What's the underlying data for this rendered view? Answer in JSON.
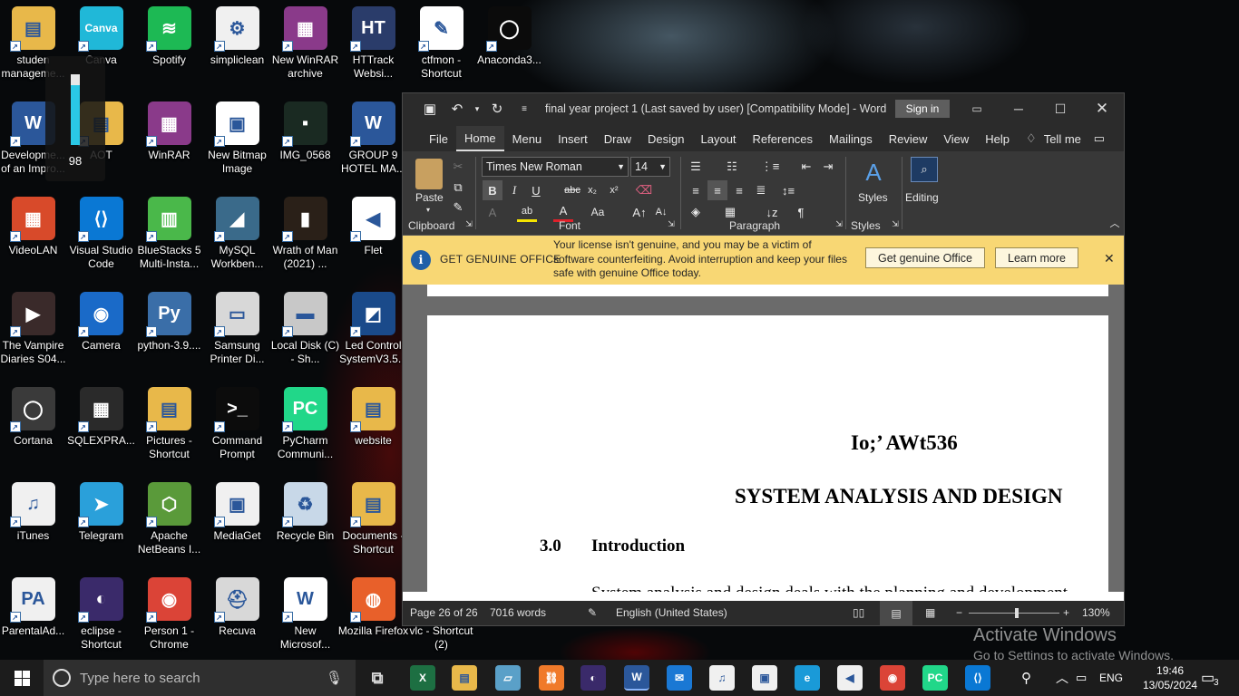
{
  "desktop": {
    "icons": [
      {
        "label": "studen manageme...",
        "icon": "folder-icon",
        "color": "#e8b84a",
        "glyph": "▤"
      },
      {
        "label": "Canva",
        "icon": "canva-icon",
        "color": "#20b8d8",
        "glyph": "Canva"
      },
      {
        "label": "Spotify",
        "icon": "spotify-icon",
        "color": "#1db954",
        "glyph": "≋"
      },
      {
        "label": "simpliclean",
        "icon": "gear-icon",
        "color": "#f0f0f0",
        "glyph": "⚙"
      },
      {
        "label": "New WinRAR archive",
        "icon": "winrar-icon",
        "color": "#8a3a8a",
        "glyph": "▦"
      },
      {
        "label": "HTTrack Websi...",
        "icon": "httrack-icon",
        "color": "#2a3c6a",
        "glyph": "HT"
      },
      {
        "label": "ctfmon - Shortcut",
        "icon": "ctfmon-icon",
        "color": "#ffffff",
        "glyph": "✎"
      },
      {
        "label": "Anaconda3...",
        "icon": "anaconda-icon",
        "color": "#0b0b0b",
        "glyph": "◯"
      },
      {
        "label": "Developme... of an Impro...",
        "icon": "word-document-icon",
        "color": "#2b579a",
        "glyph": "W"
      },
      {
        "label": "AOT",
        "icon": "folder-icon",
        "color": "#e8b84a",
        "glyph": "▤"
      },
      {
        "label": "WinRAR",
        "icon": "winrar-icon",
        "color": "#8a3a8a",
        "glyph": "▦"
      },
      {
        "label": "New Bitmap Image",
        "icon": "bitmap-icon",
        "color": "#ffffff",
        "glyph": "▣"
      },
      {
        "label": "IMG_0568",
        "icon": "image-icon",
        "color": "#1a2a22",
        "glyph": "▪"
      },
      {
        "label": "GROUP 9 HOTEL MA...",
        "icon": "word-document-icon",
        "color": "#2b579a",
        "glyph": "W"
      },
      {
        "label": "VideoLAN",
        "icon": "winrar-icon",
        "color": "#d84a2a",
        "glyph": "▦"
      },
      {
        "label": "Visual Studio Code",
        "icon": "vscode-icon",
        "color": "#0a78d4",
        "glyph": "⟨⟩"
      },
      {
        "label": "BlueStacks 5 Multi-Insta...",
        "icon": "bluestacks-icon",
        "color": "#4ab84a",
        "glyph": "▥"
      },
      {
        "label": "MySQL Workben...",
        "icon": "mysql-icon",
        "color": "#3a6a8a",
        "glyph": "◢"
      },
      {
        "label": "Wrath of Man (2021) ...",
        "icon": "movie-icon",
        "color": "#2a2018",
        "glyph": "▮"
      },
      {
        "label": "Flet",
        "icon": "flet-icon",
        "color": "#ffffff",
        "glyph": "◀"
      },
      {
        "label": "The Vampire Diaries S04...",
        "icon": "video-icon",
        "color": "#3a2a2a",
        "glyph": "▶"
      },
      {
        "label": "Camera",
        "icon": "camera-icon",
        "color": "#1a6ac8",
        "glyph": "◉"
      },
      {
        "label": "python-3.9....",
        "icon": "python-icon",
        "color": "#3a6ea8",
        "glyph": "Py"
      },
      {
        "label": "Samsung Printer Di...",
        "icon": "printer-icon",
        "color": "#d8d8d8",
        "glyph": "▭"
      },
      {
        "label": "Local Disk (C) - Sh...",
        "icon": "disk-icon",
        "color": "#c8c8c8",
        "glyph": "▬"
      },
      {
        "label": "Led Control SystemV3.5...",
        "icon": "led-icon",
        "color": "#1a4a8a",
        "glyph": "◩"
      },
      {
        "label": "Cortana",
        "icon": "cortana-icon",
        "color": "#3a3a3a",
        "glyph": "◯"
      },
      {
        "label": "SQLEXPRA...",
        "icon": "sqlexpress-icon",
        "color": "#2a2a2a",
        "glyph": "▦"
      },
      {
        "label": "Pictures - Shortcut",
        "icon": "folder-icon",
        "color": "#e8b84a",
        "glyph": "▤"
      },
      {
        "label": "Command Prompt",
        "icon": "terminal-icon",
        "color": "#0c0c0c",
        "glyph": ">_"
      },
      {
        "label": "PyCharm Communi...",
        "icon": "pycharm-icon",
        "color": "#21d789",
        "glyph": "PC"
      },
      {
        "label": "website",
        "icon": "folder-icon",
        "color": "#e8b84a",
        "glyph": "▤"
      },
      {
        "label": "iTunes",
        "icon": "itunes-icon",
        "color": "#f0f0f0",
        "glyph": "♫"
      },
      {
        "label": "Telegram",
        "icon": "telegram-icon",
        "color": "#2aa0da",
        "glyph": "➤"
      },
      {
        "label": "Apache NetBeans I...",
        "icon": "netbeans-icon",
        "color": "#5a9a3a",
        "glyph": "⬡"
      },
      {
        "label": "MediaGet",
        "icon": "mediaget-icon",
        "color": "#f0f0f0",
        "glyph": "▣"
      },
      {
        "label": "Recycle Bin",
        "icon": "recycle-bin-icon",
        "color": "#c8d8e8",
        "glyph": "♻"
      },
      {
        "label": "Documents - Shortcut",
        "icon": "folder-icon",
        "color": "#e8b84a",
        "glyph": "▤"
      },
      {
        "label": "ParentalAd...",
        "icon": "parental-advisory-icon",
        "color": "#f0f0f0",
        "glyph": "PA"
      },
      {
        "label": "eclipse - Shortcut",
        "icon": "eclipse-icon",
        "color": "#3a2a6a",
        "glyph": "◐"
      },
      {
        "label": "Person 1 - Chrome",
        "icon": "chrome-icon",
        "color": "#db4437",
        "glyph": "◉"
      },
      {
        "label": "Recuva",
        "icon": "recuva-icon",
        "color": "#d8d8d8",
        "glyph": "⛑"
      },
      {
        "label": "New Microsof...",
        "icon": "word-document-icon",
        "color": "#ffffff",
        "glyph": "W"
      },
      {
        "label": "Mozilla Firefox",
        "icon": "firefox-icon",
        "color": "#e8602a",
        "glyph": "◍"
      },
      {
        "label": "vlc - Shortcut (2)",
        "icon": "vlc-icon",
        "color": "#e88a1a",
        "glyph": "▲"
      }
    ],
    "widget_value": "98",
    "widget_fill": 0.98,
    "activate_title": "Activate Windows",
    "activate_sub": "Go to Settings to activate Windows."
  },
  "word": {
    "title": "final year project 1 (Last saved by user) [Compatibility Mode]  -  Word",
    "sign_in": "Sign in",
    "tabs": [
      "File",
      "Home",
      "Menu",
      "Insert",
      "Draw",
      "Design",
      "Layout",
      "References",
      "Mailings",
      "Review",
      "View",
      "Help"
    ],
    "tell_me": "Tell me",
    "ribbon": {
      "paste": "Paste",
      "clipboard": "Clipboard",
      "font_name": "Times New Roman",
      "font_size": "14",
      "font": "Font",
      "paragraph": "Paragraph",
      "styles": "Styles",
      "styles_group": "Styles",
      "editing": "Editing"
    },
    "notice": {
      "head": "GET GENUINE OFFICE",
      "message": "Your license isn't genuine, and you may be a victim of software counterfeiting. Avoid interruption and keep your files safe with genuine Office today.",
      "primary": "Get genuine Office",
      "secondary": "Learn more"
    },
    "document": {
      "line1": "Io;’ AWt536",
      "heading": "SYSTEM ANALYSIS AND DESIGN",
      "section_num": "3.0",
      "section_title": "Introduction",
      "body": "System analysis and design deals with the planning and development"
    },
    "status": {
      "page": "Page 26 of 26",
      "words": "7016 words",
      "language": "English (United States)",
      "zoom": "130%"
    }
  },
  "taskbar": {
    "search_placeholder": "Type here to search",
    "apps": [
      {
        "name": "excel-icon",
        "color": "#1d6f42",
        "glyph": "X"
      },
      {
        "name": "file-explorer-icon",
        "color": "#e8b84a",
        "glyph": "▤"
      },
      {
        "name": "notepad-icon",
        "color": "#5aa0c8",
        "glyph": "▱"
      },
      {
        "name": "xampp-icon",
        "color": "#f07a2a",
        "glyph": "⛓"
      },
      {
        "name": "eclipse-icon",
        "color": "#3a2a6a",
        "glyph": "◐"
      },
      {
        "name": "word-icon",
        "color": "#2b579a",
        "glyph": "W"
      },
      {
        "name": "mail-icon",
        "color": "#1a78d4",
        "glyph": "✉"
      },
      {
        "name": "itunes-icon",
        "color": "#f0f0f0",
        "glyph": "♫"
      },
      {
        "name": "store-icon",
        "color": "#f0f0f0",
        "glyph": "▣"
      },
      {
        "name": "edge-icon",
        "color": "#1a9ad8",
        "glyph": "e"
      },
      {
        "name": "flet-icon",
        "color": "#f0f0f0",
        "glyph": "◀"
      },
      {
        "name": "chrome-icon",
        "color": "#db4437",
        "glyph": "◉"
      },
      {
        "name": "pycharm-icon",
        "color": "#21d789",
        "glyph": "PC"
      },
      {
        "name": "vscode-icon",
        "color": "#0a78d4",
        "glyph": "⟨⟩"
      }
    ],
    "language": "ENG",
    "time": "19:46",
    "date": "13/05/2024",
    "notifications": "3"
  }
}
